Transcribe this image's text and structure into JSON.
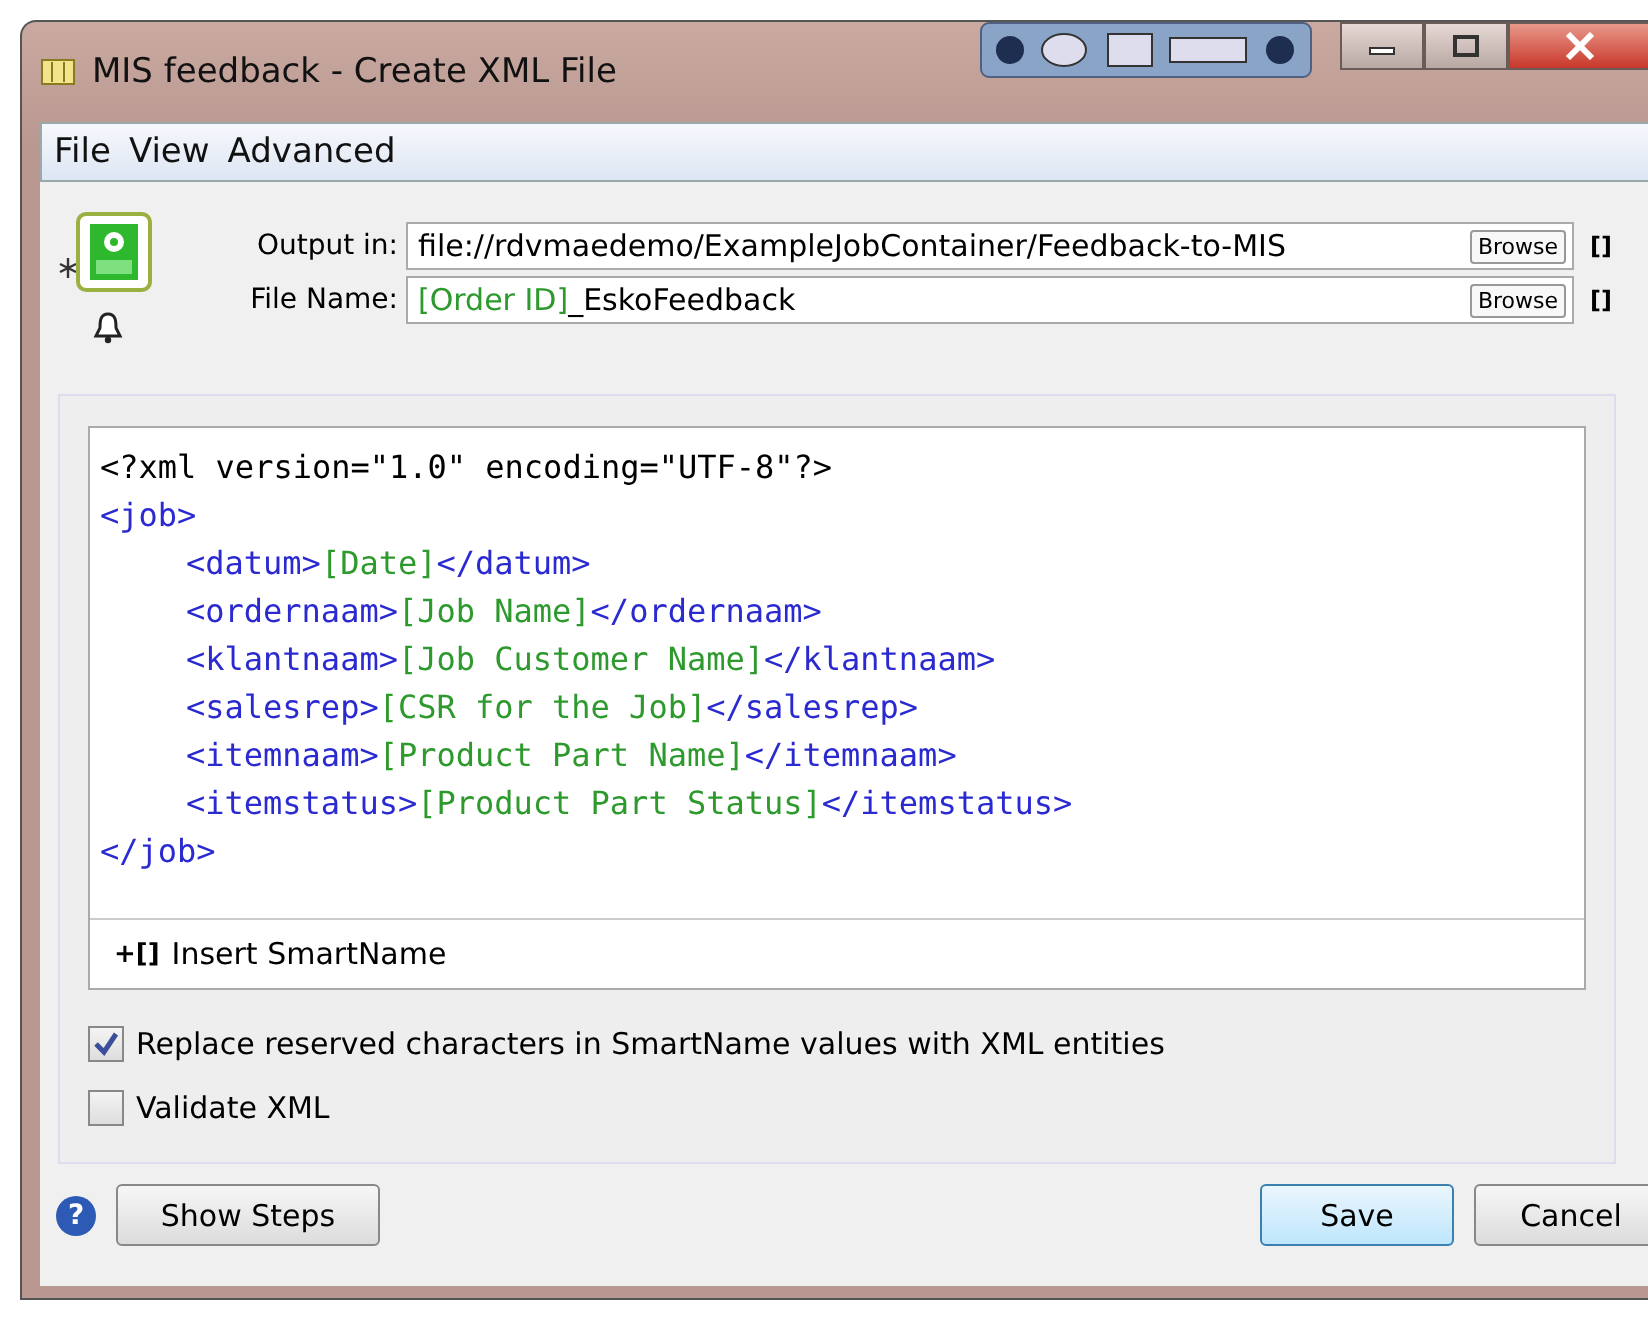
{
  "window": {
    "title": "MIS feedback - Create XML File"
  },
  "menu": [
    "File",
    "View",
    "Advanced"
  ],
  "fields": [
    {
      "label": "Output in:",
      "segments": [
        {
          "kind": "plain",
          "text": "file://rdvmaedemo/ExampleJobContainer/Feedback-to-MIS"
        }
      ],
      "browse": "Browse",
      "smartname": "[]"
    },
    {
      "label": "File Name:",
      "segments": [
        {
          "kind": "smart",
          "text": "[Order ID]"
        },
        {
          "kind": "plain",
          "text": "_EskoFeedback"
        }
      ],
      "browse": "Browse",
      "smartname": "[]"
    }
  ],
  "xml_lines": [
    {
      "indent": false,
      "segments": [
        {
          "kind": "plain",
          "text": "<?xml version=\"1.0\" encoding=\"UTF-8\"?>"
        }
      ]
    },
    {
      "indent": false,
      "segments": [
        {
          "kind": "tag",
          "text": "<job>"
        }
      ]
    },
    {
      "indent": true,
      "segments": [
        {
          "kind": "tag",
          "text": "<datum>"
        },
        {
          "kind": "smart",
          "text": "[Date]"
        },
        {
          "kind": "tag",
          "text": "</datum>"
        }
      ]
    },
    {
      "indent": true,
      "segments": [
        {
          "kind": "tag",
          "text": "<ordernaam>"
        },
        {
          "kind": "smart",
          "text": "[Job Name]"
        },
        {
          "kind": "tag",
          "text": "</ordernaam>"
        }
      ]
    },
    {
      "indent": true,
      "segments": [
        {
          "kind": "tag",
          "text": "<klantnaam>"
        },
        {
          "kind": "smart",
          "text": "[Job Customer Name]"
        },
        {
          "kind": "tag",
          "text": "</klantnaam>"
        }
      ]
    },
    {
      "indent": true,
      "segments": [
        {
          "kind": "tag",
          "text": "<salesrep>"
        },
        {
          "kind": "smart",
          "text": "[CSR for the Job]"
        },
        {
          "kind": "tag",
          "text": "</salesrep>"
        }
      ]
    },
    {
      "indent": true,
      "segments": [
        {
          "kind": "tag",
          "text": "<itemnaam>"
        },
        {
          "kind": "smart",
          "text": "[Product Part Name]"
        },
        {
          "kind": "tag",
          "text": "</itemnaam>"
        }
      ]
    },
    {
      "indent": true,
      "segments": [
        {
          "kind": "tag",
          "text": "<itemstatus>"
        },
        {
          "kind": "smart",
          "text": "[Product Part Status]"
        },
        {
          "kind": "tag",
          "text": "</itemstatus>"
        }
      ]
    },
    {
      "indent": false,
      "segments": [
        {
          "kind": "tag",
          "text": "</job>"
        }
      ]
    }
  ],
  "insert_smartname": {
    "icon": "+[]",
    "label": "Insert SmartName"
  },
  "options": [
    {
      "label": "Replace reserved characters in SmartName values with XML entities",
      "checked": true
    },
    {
      "label": "Validate XML",
      "checked": false
    }
  ],
  "footer": {
    "help": "?",
    "show_steps": "Show Steps",
    "save": "Save",
    "cancel": "Cancel"
  }
}
